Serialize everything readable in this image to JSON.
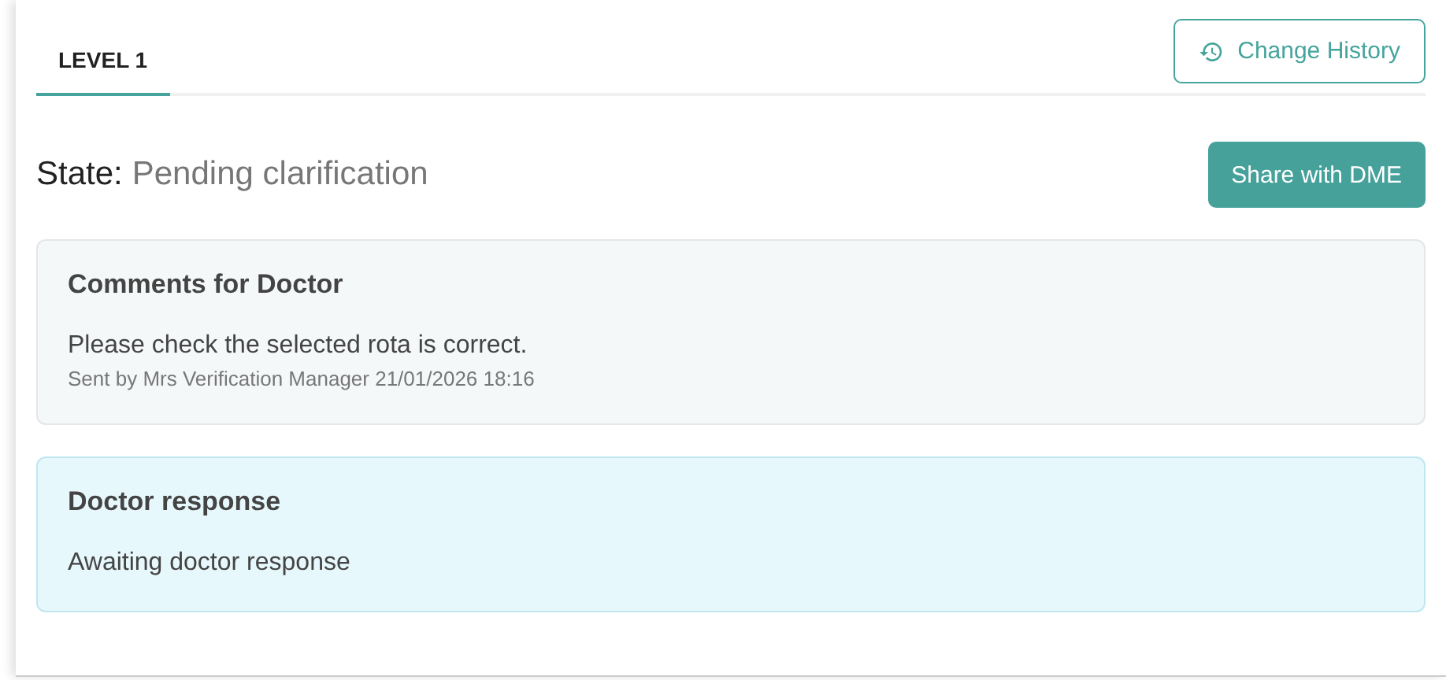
{
  "tabs": [
    {
      "label": "LEVEL 1",
      "selected": true
    }
  ],
  "change_history_button": "Change History",
  "state": {
    "label": "State:",
    "value": "Pending clarification"
  },
  "share_button": "Share with DME",
  "panels": [
    {
      "kind": "comment",
      "title": "Comments for Doctor",
      "text": "Please check the selected rota is correct.",
      "meta": "Sent by Mrs Verification Manager 21/01/2026 18:16"
    },
    {
      "kind": "response",
      "title": "Doctor response",
      "text": "Awaiting doctor response"
    }
  ]
}
